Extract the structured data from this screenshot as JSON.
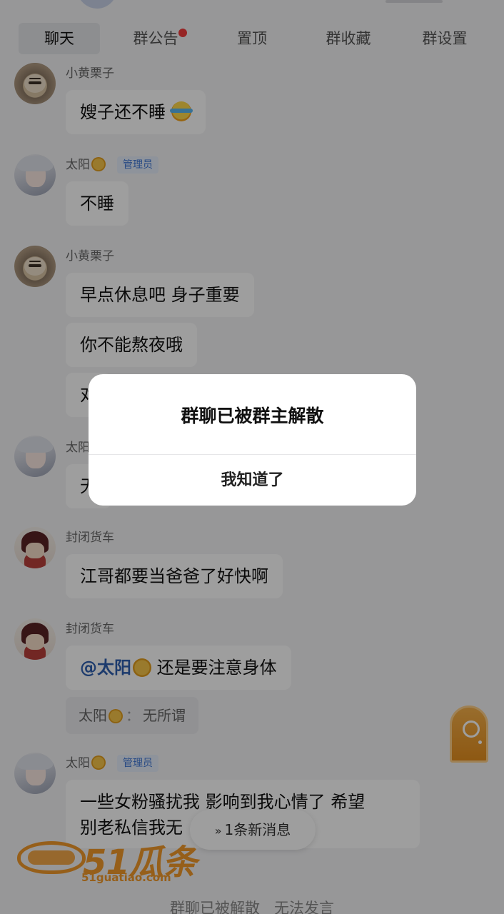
{
  "tabs": [
    {
      "label": "聊天",
      "active": true
    },
    {
      "label": "群公告",
      "has_dot": true
    },
    {
      "label": "置顶"
    },
    {
      "label": "群收藏"
    },
    {
      "label": "群设置"
    }
  ],
  "messages": [
    {
      "sender": "小黄栗子",
      "text": "嫂子还不睡",
      "emoji": "laughing-crying-emoji"
    },
    {
      "sender": "太阳",
      "role_badge": "管理员",
      "text": "不睡",
      "emoji": "sun-emoji"
    },
    {
      "sender": "小黄栗子",
      "texts": [
        "早点休息吧 身子重要",
        "你不能熬夜哦",
        "对"
      ]
    },
    {
      "sender": "太阳",
      "text": "无"
    },
    {
      "sender": "封闭货车",
      "text": "江哥都要当爸爸了好快啊"
    },
    {
      "sender": "封闭货车",
      "mention": "@太阳",
      "text": "还是要注意身体",
      "quote": {
        "sender": "太阳",
        "separator": "：",
        "text": "无所谓"
      }
    },
    {
      "sender": "太阳",
      "role_badge": "管理员",
      "text_line1": "一些女粉骚扰我 影响到我心情了 希望",
      "text_line2": "别老私信我无"
    }
  ],
  "new_message_pill": {
    "chevron": "»",
    "label": "1条新消息"
  },
  "bottom_status": "群聊已被解散   无法发言",
  "watermark": {
    "text": "51瓜条",
    "url": "51guatiao.com"
  },
  "dialog": {
    "title": "群聊已被群主解散",
    "button": "我知道了"
  },
  "colors": {
    "overlay": "#00000061",
    "badge_text": "#3f77d6",
    "unread_dot": "#f23a3a",
    "mention": "#2f5fb0",
    "watermark": "#f39a2a"
  }
}
